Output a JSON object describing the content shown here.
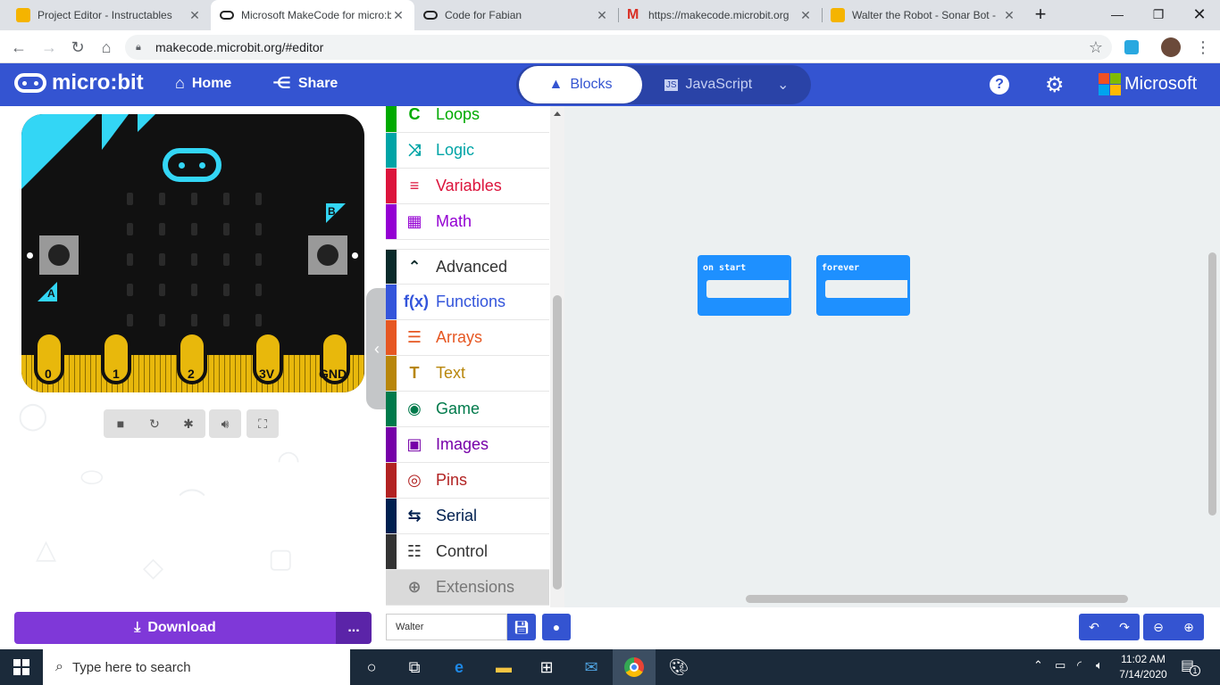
{
  "browser": {
    "tabs": [
      {
        "title": "Project Editor - Instructables"
      },
      {
        "title": "Microsoft MakeCode for micro:b"
      },
      {
        "title": "Code for Fabian"
      },
      {
        "title": "https://makecode.microbit.org"
      },
      {
        "title": "Walter the Robot - Sonar Bot -"
      }
    ],
    "url": "makecode.microbit.org/#editor"
  },
  "header": {
    "brand": "micro:bit",
    "home_label": "Home",
    "share_label": "Share",
    "blocks_label": "Blocks",
    "javascript_label": "JavaScript",
    "microsoft_label": "Microsoft"
  },
  "simulator": {
    "pins": [
      "0",
      "1",
      "2",
      "3V",
      "GND"
    ],
    "button_a": "A",
    "button_b": "B"
  },
  "toolbox": {
    "categories": [
      {
        "label": "Loops",
        "color": "#00aa00",
        "icon": "C"
      },
      {
        "label": "Logic",
        "color": "#00a4a6",
        "icon": "⤨"
      },
      {
        "label": "Variables",
        "color": "#dc143c",
        "icon": "≡"
      },
      {
        "label": "Math",
        "color": "#9400d3",
        "icon": "▦"
      }
    ],
    "advanced_label": "Advanced",
    "advanced_categories": [
      {
        "label": "Functions",
        "color": "#3455db",
        "icon": "f(x)"
      },
      {
        "label": "Arrays",
        "color": "#e65722",
        "icon": "☰"
      },
      {
        "label": "Text",
        "color": "#b8860b",
        "icon": "T"
      },
      {
        "label": "Game",
        "color": "#007a4b",
        "icon": "◉"
      },
      {
        "label": "Images",
        "color": "#7600a8",
        "icon": "▣"
      },
      {
        "label": "Pins",
        "color": "#b22222",
        "icon": "◎"
      },
      {
        "label": "Serial",
        "color": "#002050",
        "icon": "⇆"
      },
      {
        "label": "Control",
        "color": "#333333",
        "icon": "☷"
      },
      {
        "label": "Extensions",
        "color": "#777777",
        "icon": "⊕"
      }
    ]
  },
  "workspace": {
    "blocks": [
      {
        "label": "on start"
      },
      {
        "label": "forever"
      }
    ]
  },
  "bottombar": {
    "download_label": "Download",
    "more_label": "...",
    "project_name": "Walter"
  },
  "taskbar": {
    "search_placeholder": "Type here to search",
    "time": "11:02 AM",
    "date": "7/14/2020",
    "notification_count": "1"
  }
}
